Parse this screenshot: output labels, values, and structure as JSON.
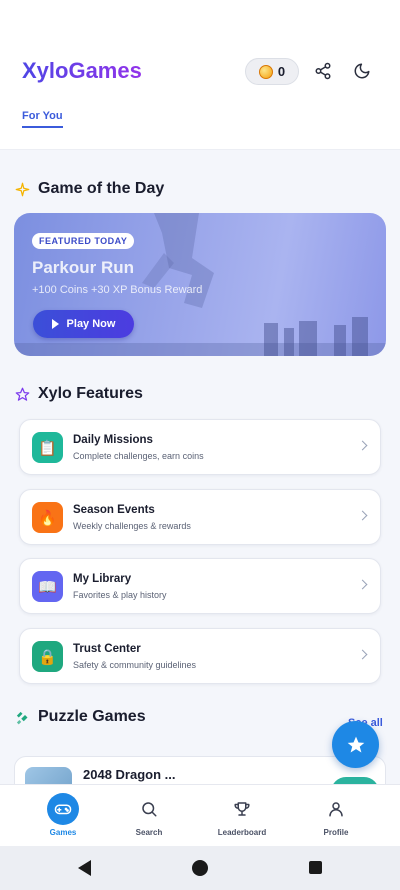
{
  "app": {
    "title": "XyloGames"
  },
  "header": {
    "coins": "0",
    "tab_for_you": "For You"
  },
  "game_of_day": {
    "section_title": "Game of the Day",
    "badge": "FEATURED TODAY",
    "title": "Parkour Run",
    "subtitle": "+100 Coins +30 XP Bonus Reward",
    "play_label": "Play Now"
  },
  "features": {
    "section_title": "Xylo Features",
    "items": [
      {
        "title": "Daily Missions",
        "subtitle": "Complete challenges, earn coins",
        "icon": "clipboard-icon",
        "glyph": "📋",
        "color": "#1fb89a"
      },
      {
        "title": "Season Events",
        "subtitle": "Weekly challenges & rewards",
        "icon": "fire-icon",
        "glyph": "🔥",
        "color": "#f97316"
      },
      {
        "title": "My Library",
        "subtitle": "Favorites & play history",
        "icon": "book-icon",
        "glyph": "📖",
        "color": "#6366f1"
      },
      {
        "title": "Trust Center",
        "subtitle": "Safety & community guidelines",
        "icon": "lock-icon",
        "glyph": "🔒",
        "color": "#1fa87f"
      }
    ]
  },
  "puzzle": {
    "section_title": "Puzzle Games",
    "see_all": "See all",
    "game_title": "2048 Dragon ..."
  },
  "bottom_nav": {
    "items": [
      {
        "label": "Games",
        "icon": "gamepad-icon"
      },
      {
        "label": "Search",
        "icon": "search-icon"
      },
      {
        "label": "Leaderboard",
        "icon": "trophy-icon"
      },
      {
        "label": "Profile",
        "icon": "person-icon"
      }
    ]
  },
  "colors": {
    "accent": "#1e88e5",
    "brand_start": "#4f46e5",
    "brand_end": "#9333ea"
  }
}
